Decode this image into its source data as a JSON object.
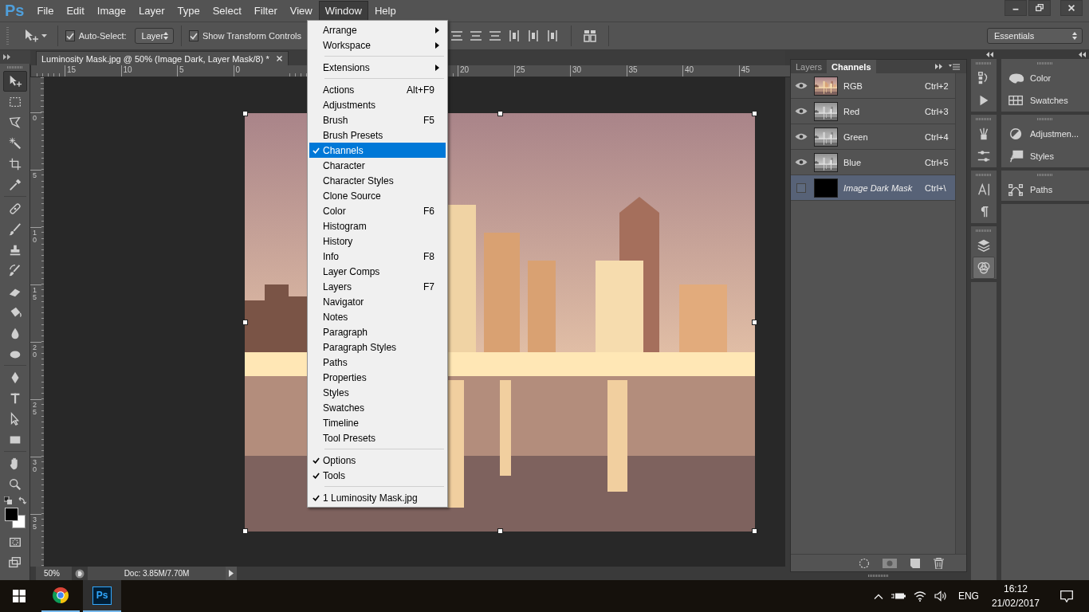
{
  "app_logo": "Ps",
  "menu_bar": [
    {
      "label": "File",
      "open": false
    },
    {
      "label": "Edit",
      "open": false
    },
    {
      "label": "Image",
      "open": false
    },
    {
      "label": "Layer",
      "open": false
    },
    {
      "label": "Type",
      "open": false
    },
    {
      "label": "Select",
      "open": false
    },
    {
      "label": "Filter",
      "open": false
    },
    {
      "label": "View",
      "open": false
    },
    {
      "label": "Window",
      "open": true
    },
    {
      "label": "Help",
      "open": false
    }
  ],
  "options_bar": {
    "auto_select": {
      "label": "Auto-Select:",
      "checked": true
    },
    "auto_select_target": "Layer",
    "show_transform_controls": {
      "label": "Show Transform Controls",
      "checked": true
    },
    "workspace": "Essentials"
  },
  "tool_groups": [
    [
      {
        "kind": "move",
        "selected": true
      },
      {
        "kind": "marquee",
        "selected": false
      },
      {
        "kind": "lasso",
        "selected": false
      },
      {
        "kind": "wand",
        "selected": false
      },
      {
        "kind": "crop",
        "selected": false
      },
      {
        "kind": "eyedropper",
        "selected": false
      }
    ],
    [
      {
        "kind": "healing",
        "selected": false
      },
      {
        "kind": "brush",
        "selected": false
      },
      {
        "kind": "stamp",
        "selected": false
      },
      {
        "kind": "history-brush",
        "selected": false
      },
      {
        "kind": "eraser",
        "selected": false
      },
      {
        "kind": "bucket",
        "selected": false
      },
      {
        "kind": "blur",
        "selected": false
      },
      {
        "kind": "smudge",
        "selected": false
      }
    ],
    [
      {
        "kind": "pen",
        "selected": false
      },
      {
        "kind": "type",
        "selected": false
      },
      {
        "kind": "path-select",
        "selected": false
      },
      {
        "kind": "shape",
        "selected": false
      }
    ],
    [
      {
        "kind": "hand",
        "selected": false
      },
      {
        "kind": "zoom",
        "selected": false
      }
    ]
  ],
  "document_tab": {
    "title": "Luminosity Mask.jpg @ 50% (Image Dark, Layer Mask/8) *"
  },
  "ruler_top": {
    "left_labels": [
      "15",
      "10",
      "5",
      "0"
    ],
    "right_labels": [
      "20",
      "25",
      "30",
      "35",
      "40",
      "45"
    ]
  },
  "ruler_left": {
    "labels": [
      "0",
      "5",
      "10",
      "15",
      "20",
      "25",
      "30",
      "35"
    ]
  },
  "status_bar": {
    "zoom": "50%",
    "doc_info": "Doc: 3.85M/7.70M"
  },
  "window_menu": {
    "sections": [
      {
        "items": [
          {
            "label": "Arrange",
            "submenu": true,
            "checked": false,
            "selected": false
          },
          {
            "label": "Workspace",
            "submenu": true,
            "checked": false,
            "selected": false
          }
        ]
      },
      {
        "items": [
          {
            "label": "Extensions",
            "submenu": true,
            "checked": false,
            "selected": false
          }
        ]
      },
      {
        "items": [
          {
            "label": "Actions",
            "shortcut": "Alt+F9",
            "submenu": false,
            "checked": false,
            "selected": false
          },
          {
            "label": "Adjustments",
            "submenu": false,
            "checked": false,
            "selected": false
          },
          {
            "label": "Brush",
            "shortcut": "F5",
            "submenu": false,
            "checked": false,
            "selected": false
          },
          {
            "label": "Brush Presets",
            "submenu": false,
            "checked": false,
            "selected": false
          },
          {
            "label": "Channels",
            "submenu": false,
            "checked": true,
            "selected": true
          },
          {
            "label": "Character",
            "submenu": false,
            "checked": false,
            "selected": false
          },
          {
            "label": "Character Styles",
            "submenu": false,
            "checked": false,
            "selected": false
          },
          {
            "label": "Clone Source",
            "submenu": false,
            "checked": false,
            "selected": false
          },
          {
            "label": "Color",
            "shortcut": "F6",
            "submenu": false,
            "checked": false,
            "selected": false
          },
          {
            "label": "Histogram",
            "submenu": false,
            "checked": false,
            "selected": false
          },
          {
            "label": "History",
            "submenu": false,
            "checked": false,
            "selected": false
          },
          {
            "label": "Info",
            "shortcut": "F8",
            "submenu": false,
            "checked": false,
            "selected": false
          },
          {
            "label": "Layer Comps",
            "submenu": false,
            "checked": false,
            "selected": false
          },
          {
            "label": "Layers",
            "shortcut": "F7",
            "submenu": false,
            "checked": false,
            "selected": false
          },
          {
            "label": "Navigator",
            "submenu": false,
            "checked": false,
            "selected": false
          },
          {
            "label": "Notes",
            "submenu": false,
            "checked": false,
            "selected": false
          },
          {
            "label": "Paragraph",
            "submenu": false,
            "checked": false,
            "selected": false
          },
          {
            "label": "Paragraph Styles",
            "submenu": false,
            "checked": false,
            "selected": false
          },
          {
            "label": "Paths",
            "submenu": false,
            "checked": false,
            "selected": false
          },
          {
            "label": "Properties",
            "submenu": false,
            "checked": false,
            "selected": false
          },
          {
            "label": "Styles",
            "submenu": false,
            "checked": false,
            "selected": false
          },
          {
            "label": "Swatches",
            "submenu": false,
            "checked": false,
            "selected": false
          },
          {
            "label": "Timeline",
            "submenu": false,
            "checked": false,
            "selected": false
          },
          {
            "label": "Tool Presets",
            "submenu": false,
            "checked": false,
            "selected": false
          }
        ]
      },
      {
        "items": [
          {
            "label": "Options",
            "submenu": false,
            "checked": true,
            "selected": false
          },
          {
            "label": "Tools",
            "submenu": false,
            "checked": true,
            "selected": false
          }
        ]
      },
      {
        "items": [
          {
            "label": "1 Luminosity Mask.jpg",
            "submenu": false,
            "checked": true,
            "selected": false
          }
        ]
      }
    ]
  },
  "channels_panel": {
    "tabs": [
      {
        "label": "Layers",
        "selected": false
      },
      {
        "label": "Channels",
        "selected": true
      }
    ],
    "channels": [
      {
        "name": "RGB",
        "shortcut": "Ctrl+2",
        "kind": "composite",
        "visible": true,
        "selected": false
      },
      {
        "name": "Red",
        "shortcut": "Ctrl+3",
        "kind": "channel",
        "visible": true,
        "selected": false
      },
      {
        "name": "Green",
        "shortcut": "Ctrl+4",
        "kind": "channel",
        "visible": true,
        "selected": false
      },
      {
        "name": "Blue",
        "shortcut": "Ctrl+5",
        "kind": "channel",
        "visible": true,
        "selected": false
      },
      {
        "name": "Image Dark Mask",
        "shortcut": "Ctrl+\\",
        "kind": "mask",
        "visible": false,
        "selected": true
      }
    ]
  },
  "panel_dock": [
    [
      {
        "kind": "history",
        "selected": false
      },
      {
        "kind": "actions",
        "selected": false
      }
    ],
    [
      {
        "kind": "brushes",
        "selected": false
      },
      {
        "kind": "brush-presets",
        "selected": false
      }
    ],
    [
      {
        "kind": "character",
        "selected": false
      },
      {
        "kind": "paragraph",
        "selected": false
      }
    ],
    [
      {
        "kind": "layers",
        "selected": false
      },
      {
        "kind": "channels",
        "selected": true
      }
    ]
  ],
  "panel_list": [
    [
      {
        "kind": "color",
        "label": "Color"
      },
      {
        "kind": "swatches",
        "label": "Swatches"
      }
    ],
    [
      {
        "kind": "adjustments",
        "label": "Adjustmen..."
      },
      {
        "kind": "styles",
        "label": "Styles"
      }
    ],
    [
      {
        "kind": "paths",
        "label": "Paths"
      }
    ]
  ],
  "taskbar": {
    "apps": [
      {
        "kind": "browser",
        "active": false
      },
      {
        "kind": "photoshop",
        "label": "Ps",
        "active": true
      }
    ],
    "language": "ENG",
    "time": "16:12",
    "date": "21/02/2017"
  }
}
